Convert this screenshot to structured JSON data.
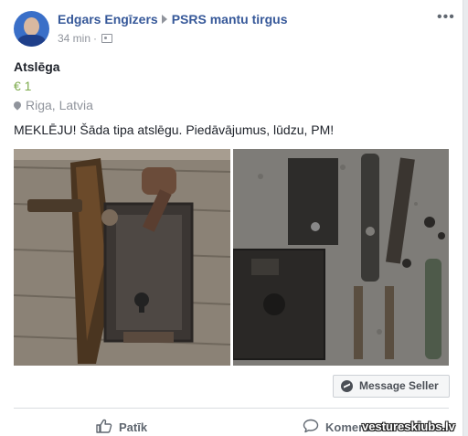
{
  "post": {
    "author": "Edgars Engīzers",
    "group": "PSRS mantu tirgus",
    "time": "34 min",
    "separator": "·",
    "more_icon": "ellipsis-icon",
    "audience_icon": "group-audience-icon"
  },
  "listing": {
    "title": "Atslēga",
    "price": "€ 1",
    "location": "Riga, Latvia",
    "description": "MEKLĒJU! Šāda tipa atslēgu. Piedāvājumus, lūdzu, PM!"
  },
  "photos": [
    {
      "subject": "old rusted door lock with key on wooden plank"
    },
    {
      "subject": "lock parts, keyhole plates, bolts and keys on concrete"
    }
  ],
  "actions": {
    "message_seller": "Message Seller",
    "like": "Patīk",
    "comment": "Komentēt"
  },
  "watermark": "vestureskiubs.lv",
  "colors": {
    "link": "#365899",
    "price": "#7dab4c",
    "muted": "#90949c"
  }
}
